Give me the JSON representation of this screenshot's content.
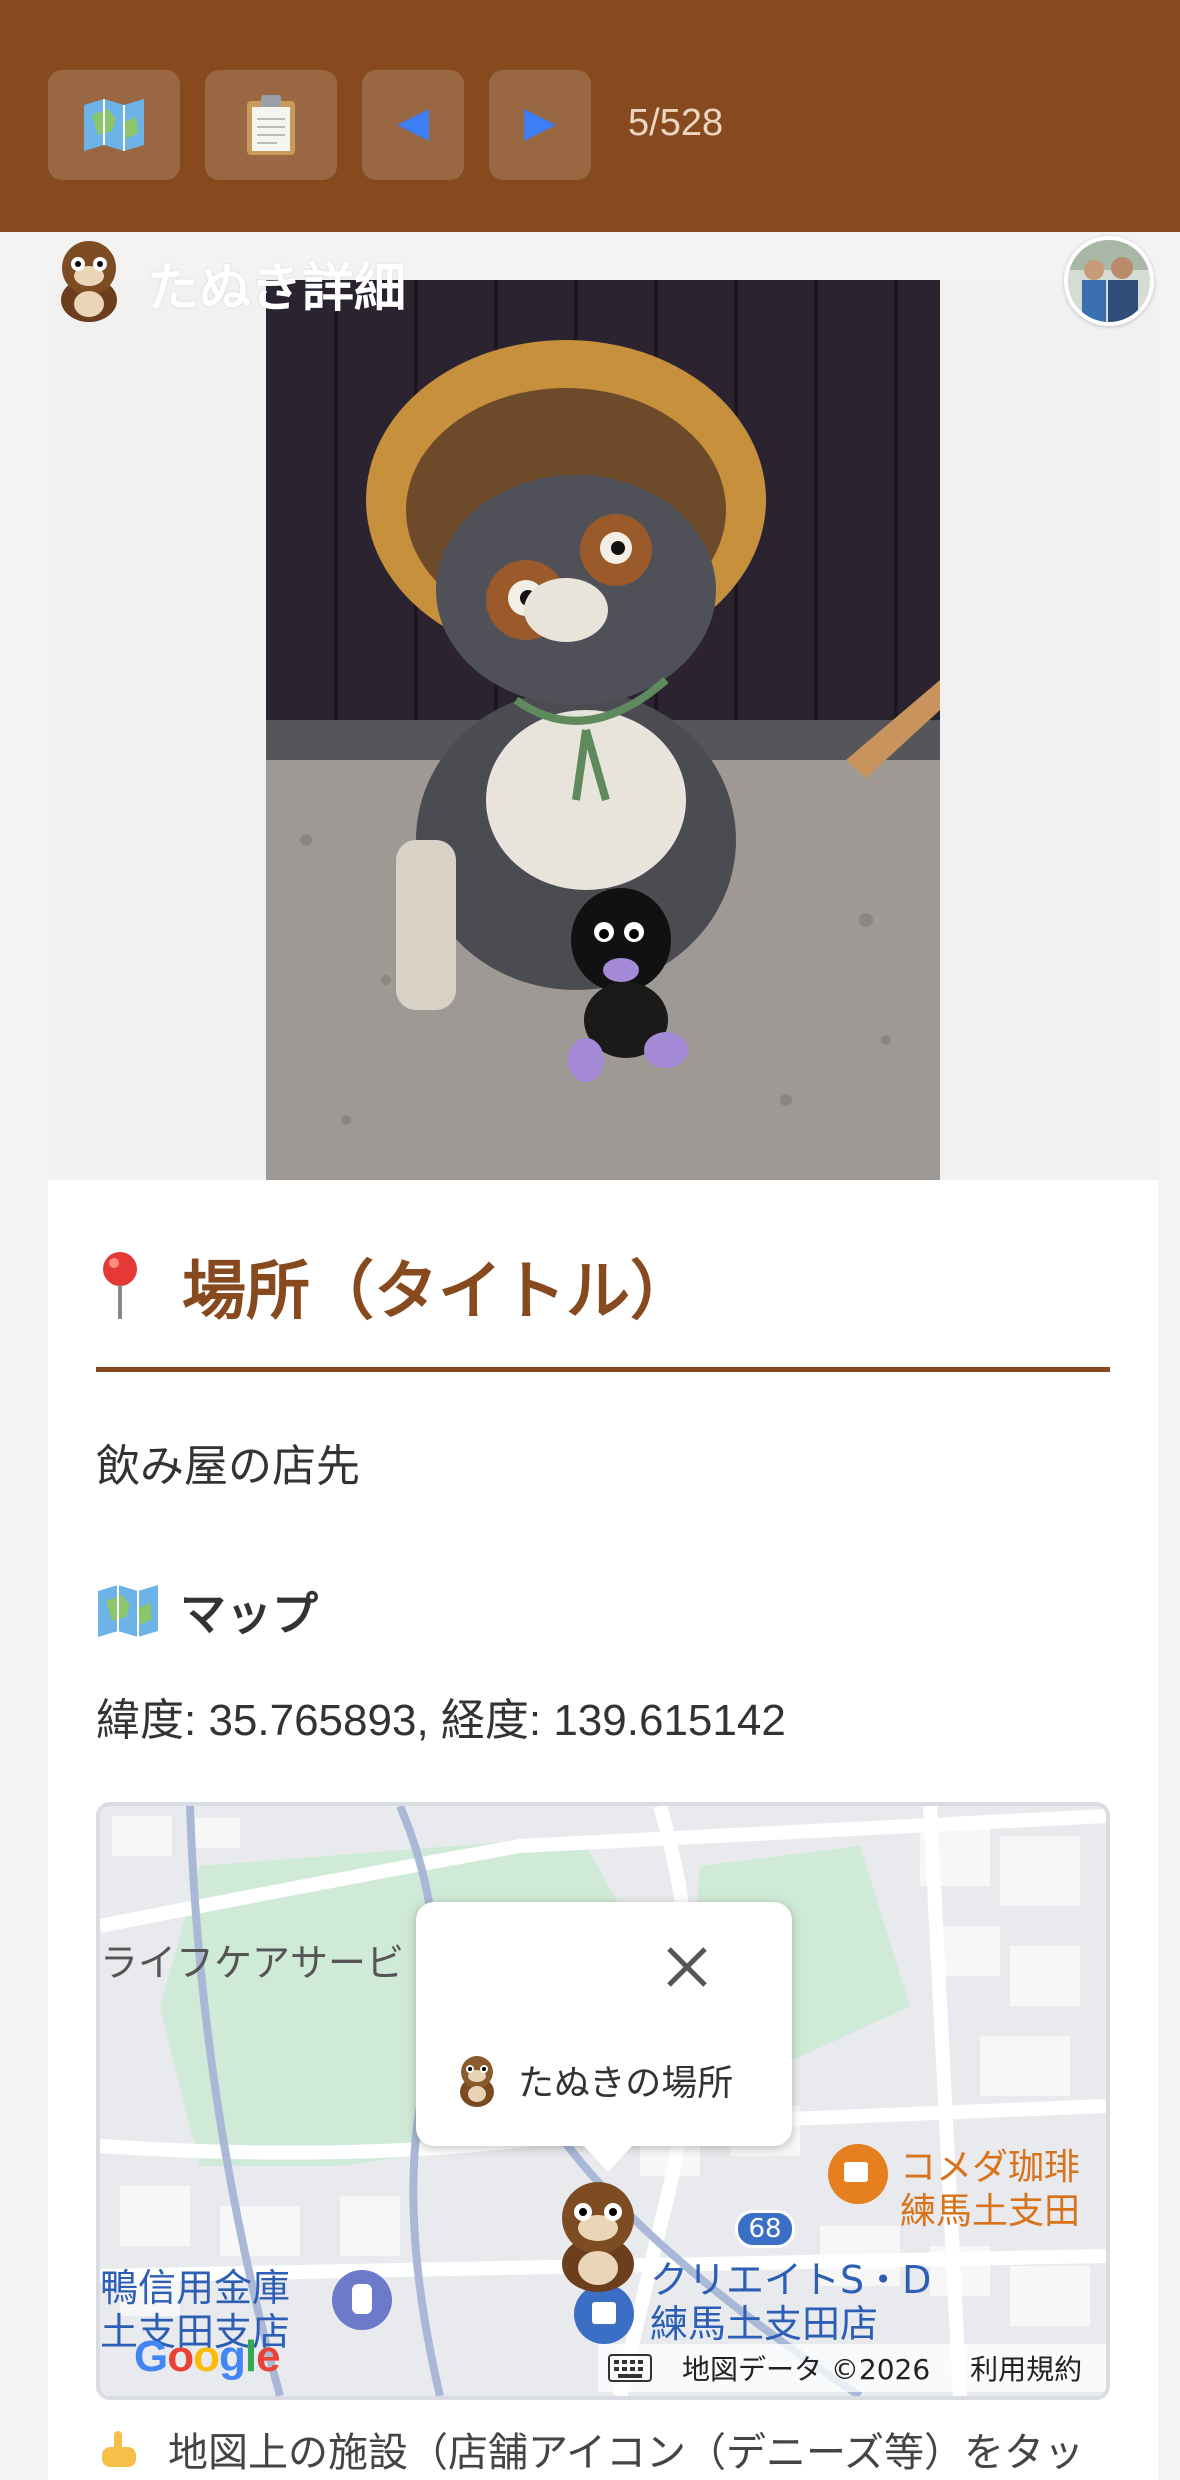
{
  "toolbar": {
    "map_button_icon": "map-icon",
    "list_button_icon": "clipboard-icon",
    "prev_button_icon": "left-arrow-icon",
    "next_button_icon": "right-arrow-icon",
    "counter": "5/528"
  },
  "header": {
    "title": "たぬき詳細"
  },
  "location": {
    "heading": "場所（タイトル）",
    "description": "飲み屋の店先"
  },
  "map": {
    "heading": "マップ",
    "coords": "緯度: 35.765893, 経度: 139.615142",
    "popup_text": "たぬきの場所",
    "labels": {
      "area_label": "ライフケアサービ",
      "cafe_label": "コメダ珈琲\n練馬土支田",
      "shop_label": "クリエイトS・D\n練馬土支田店",
      "bank_label": "鴨信用金庫\n土支田支店",
      "road_number": "68"
    },
    "footer": {
      "data_credit": "地図データ ©2026",
      "terms": "利用規約"
    }
  },
  "hint": {
    "text": "地図上の施設（店舗アイコン（デニーズ等）をタッ"
  },
  "colors": {
    "brand_brown": "#864a1e",
    "nav_arrow_blue": "#3d7ef5",
    "map_park_green": "#cfead6"
  }
}
